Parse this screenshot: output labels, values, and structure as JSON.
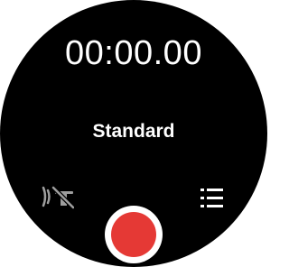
{
  "recorder": {
    "elapsed_time": "00:00.00",
    "mode_label": "Standard"
  },
  "icons": {
    "left": "mic-off-icon",
    "right": "list-icon"
  },
  "colors": {
    "background": "#000000",
    "text": "#ffffff",
    "icon": "#9e9e9e",
    "record_accent": "#e53935"
  }
}
